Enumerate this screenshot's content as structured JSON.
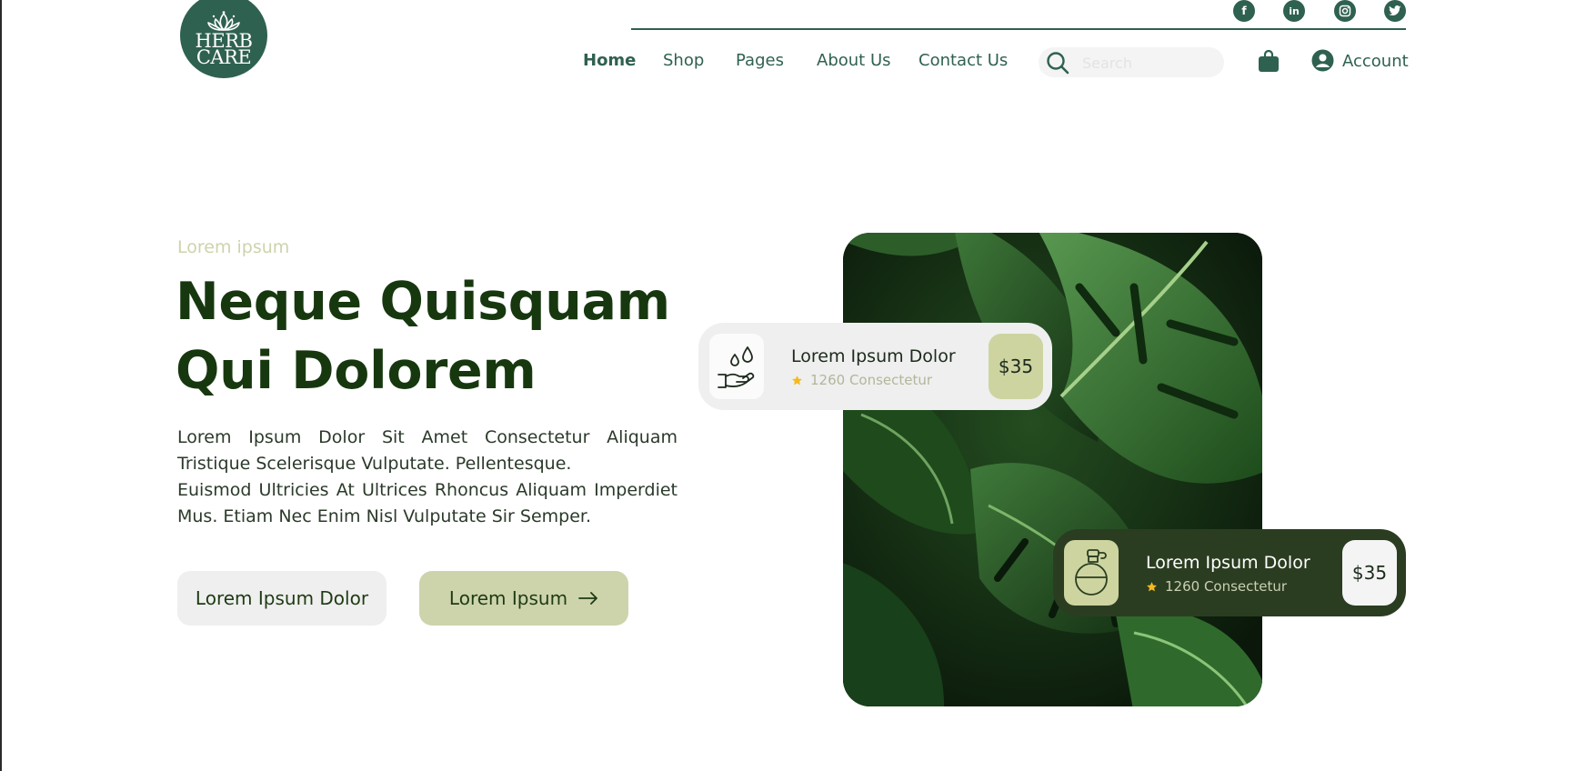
{
  "brand": {
    "line1": "HERB",
    "line2": "CARE"
  },
  "social": [
    "f",
    "in",
    "ig",
    "tw"
  ],
  "nav": {
    "items": [
      {
        "label": "Home",
        "active": true
      },
      {
        "label": "Shop"
      },
      {
        "label": "Pages"
      },
      {
        "label": "About Us"
      },
      {
        "label": "Contact Us"
      }
    ]
  },
  "search": {
    "placeholder": "Search"
  },
  "account": {
    "label": "Account"
  },
  "hero": {
    "eyebrow": "Lorem ipsum",
    "headline_line1": "Neque Quisquam",
    "headline_line2": "Qui Dolorem",
    "paragraph1": "Lorem Ipsum Dolor Sit Amet Consectetur Aliquam Tristique Scelerisque Vulputate. Pellentesque.",
    "paragraph2": "Euismod Ultricies At Ultrices Rhoncus Aliquam Imperdiet Mus. Etiam Nec Enim Nisl Vulputate Sir Semper.",
    "button_primary": "Lorem Ipsum Dolor",
    "button_secondary": "Lorem Ipsum"
  },
  "products": [
    {
      "title": "Lorem Ipsum Dolor",
      "rating_text": "1260 Consectetur",
      "price": "$35",
      "icon": "hand-water-drop-icon"
    },
    {
      "title": "Lorem Ipsum Dolor",
      "rating_text": "1260 Consectetur",
      "price": "$35",
      "icon": "perfume-bottle-icon"
    }
  ],
  "colors": {
    "brand": "#2f6150",
    "heading": "#17380f",
    "accent": "#cdd4ac",
    "dark_card": "#2b3d21",
    "star": "#f5b920"
  },
  "icons": [
    "lotus-icon",
    "facebook-icon",
    "linkedin-icon",
    "instagram-icon",
    "twitter-icon",
    "search-icon",
    "shopping-bag-icon",
    "account-icon",
    "arrow-right-icon",
    "star-icon"
  ]
}
